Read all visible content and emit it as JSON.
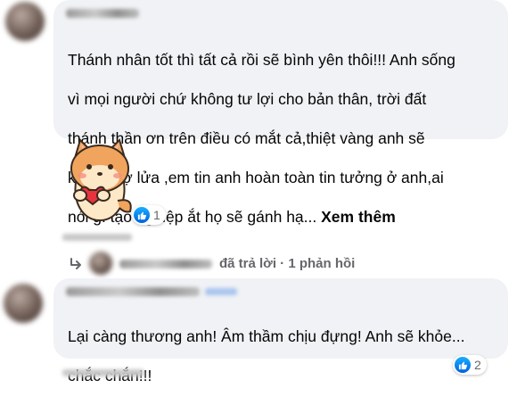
{
  "comments": [
    {
      "author": "Lý Giang",
      "text_lines": [
        "Thánh nhân tốt thì tất cả rồi sẽ bình yên thôi!!! Anh sống",
        "vì mọi người chứ không tư lợi cho bản thân, trời đất",
        "thánh thần ơn trên điều có mắt cả,thiệt vàng anh sẽ",
        "không sợ lửa ,em tin anh hoàn toàn tin tưởng ở anh,ai"
      ],
      "last_line": "nói gì tạo nghiệp ắt họ sẽ gánh hạ...",
      "see_more": "Xem thêm",
      "sticker": "shiba-dog-holding-heart",
      "reaction_count": "1"
    },
    {
      "author": "Linh Phúc Hạnh",
      "text_lines": [
        "Lại càng thương anh! Âm thầm chịu đựng! Anh sẽ khỏe...",
        "chắc chắn!!!"
      ],
      "reaction_count": "2"
    }
  ],
  "reply_summary": {
    "text": "đã trả lời · 1 phản hồi"
  },
  "colors": {
    "bubble": "#f0f2f5",
    "like_blue": "#0062df",
    "meta_gray": "#65676b"
  },
  "icons": [
    "like-icon",
    "reply-arrow-icon"
  ]
}
